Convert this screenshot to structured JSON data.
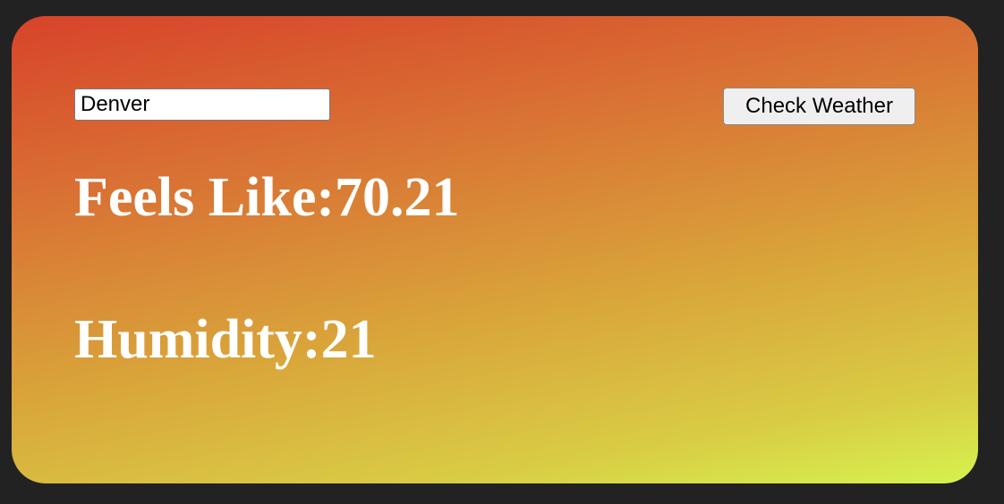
{
  "search": {
    "value": "Denver",
    "button_label": "Check Weather"
  },
  "weather": {
    "feels_like_label": "Feels Like:",
    "feels_like_value": "70.21",
    "humidity_label": "Humidity:",
    "humidity_value": "21"
  },
  "colors": {
    "page_background": "#222222",
    "gradient_top": "#d8432a",
    "gradient_bottom": "#d6f24d",
    "text": "#ffffff"
  }
}
